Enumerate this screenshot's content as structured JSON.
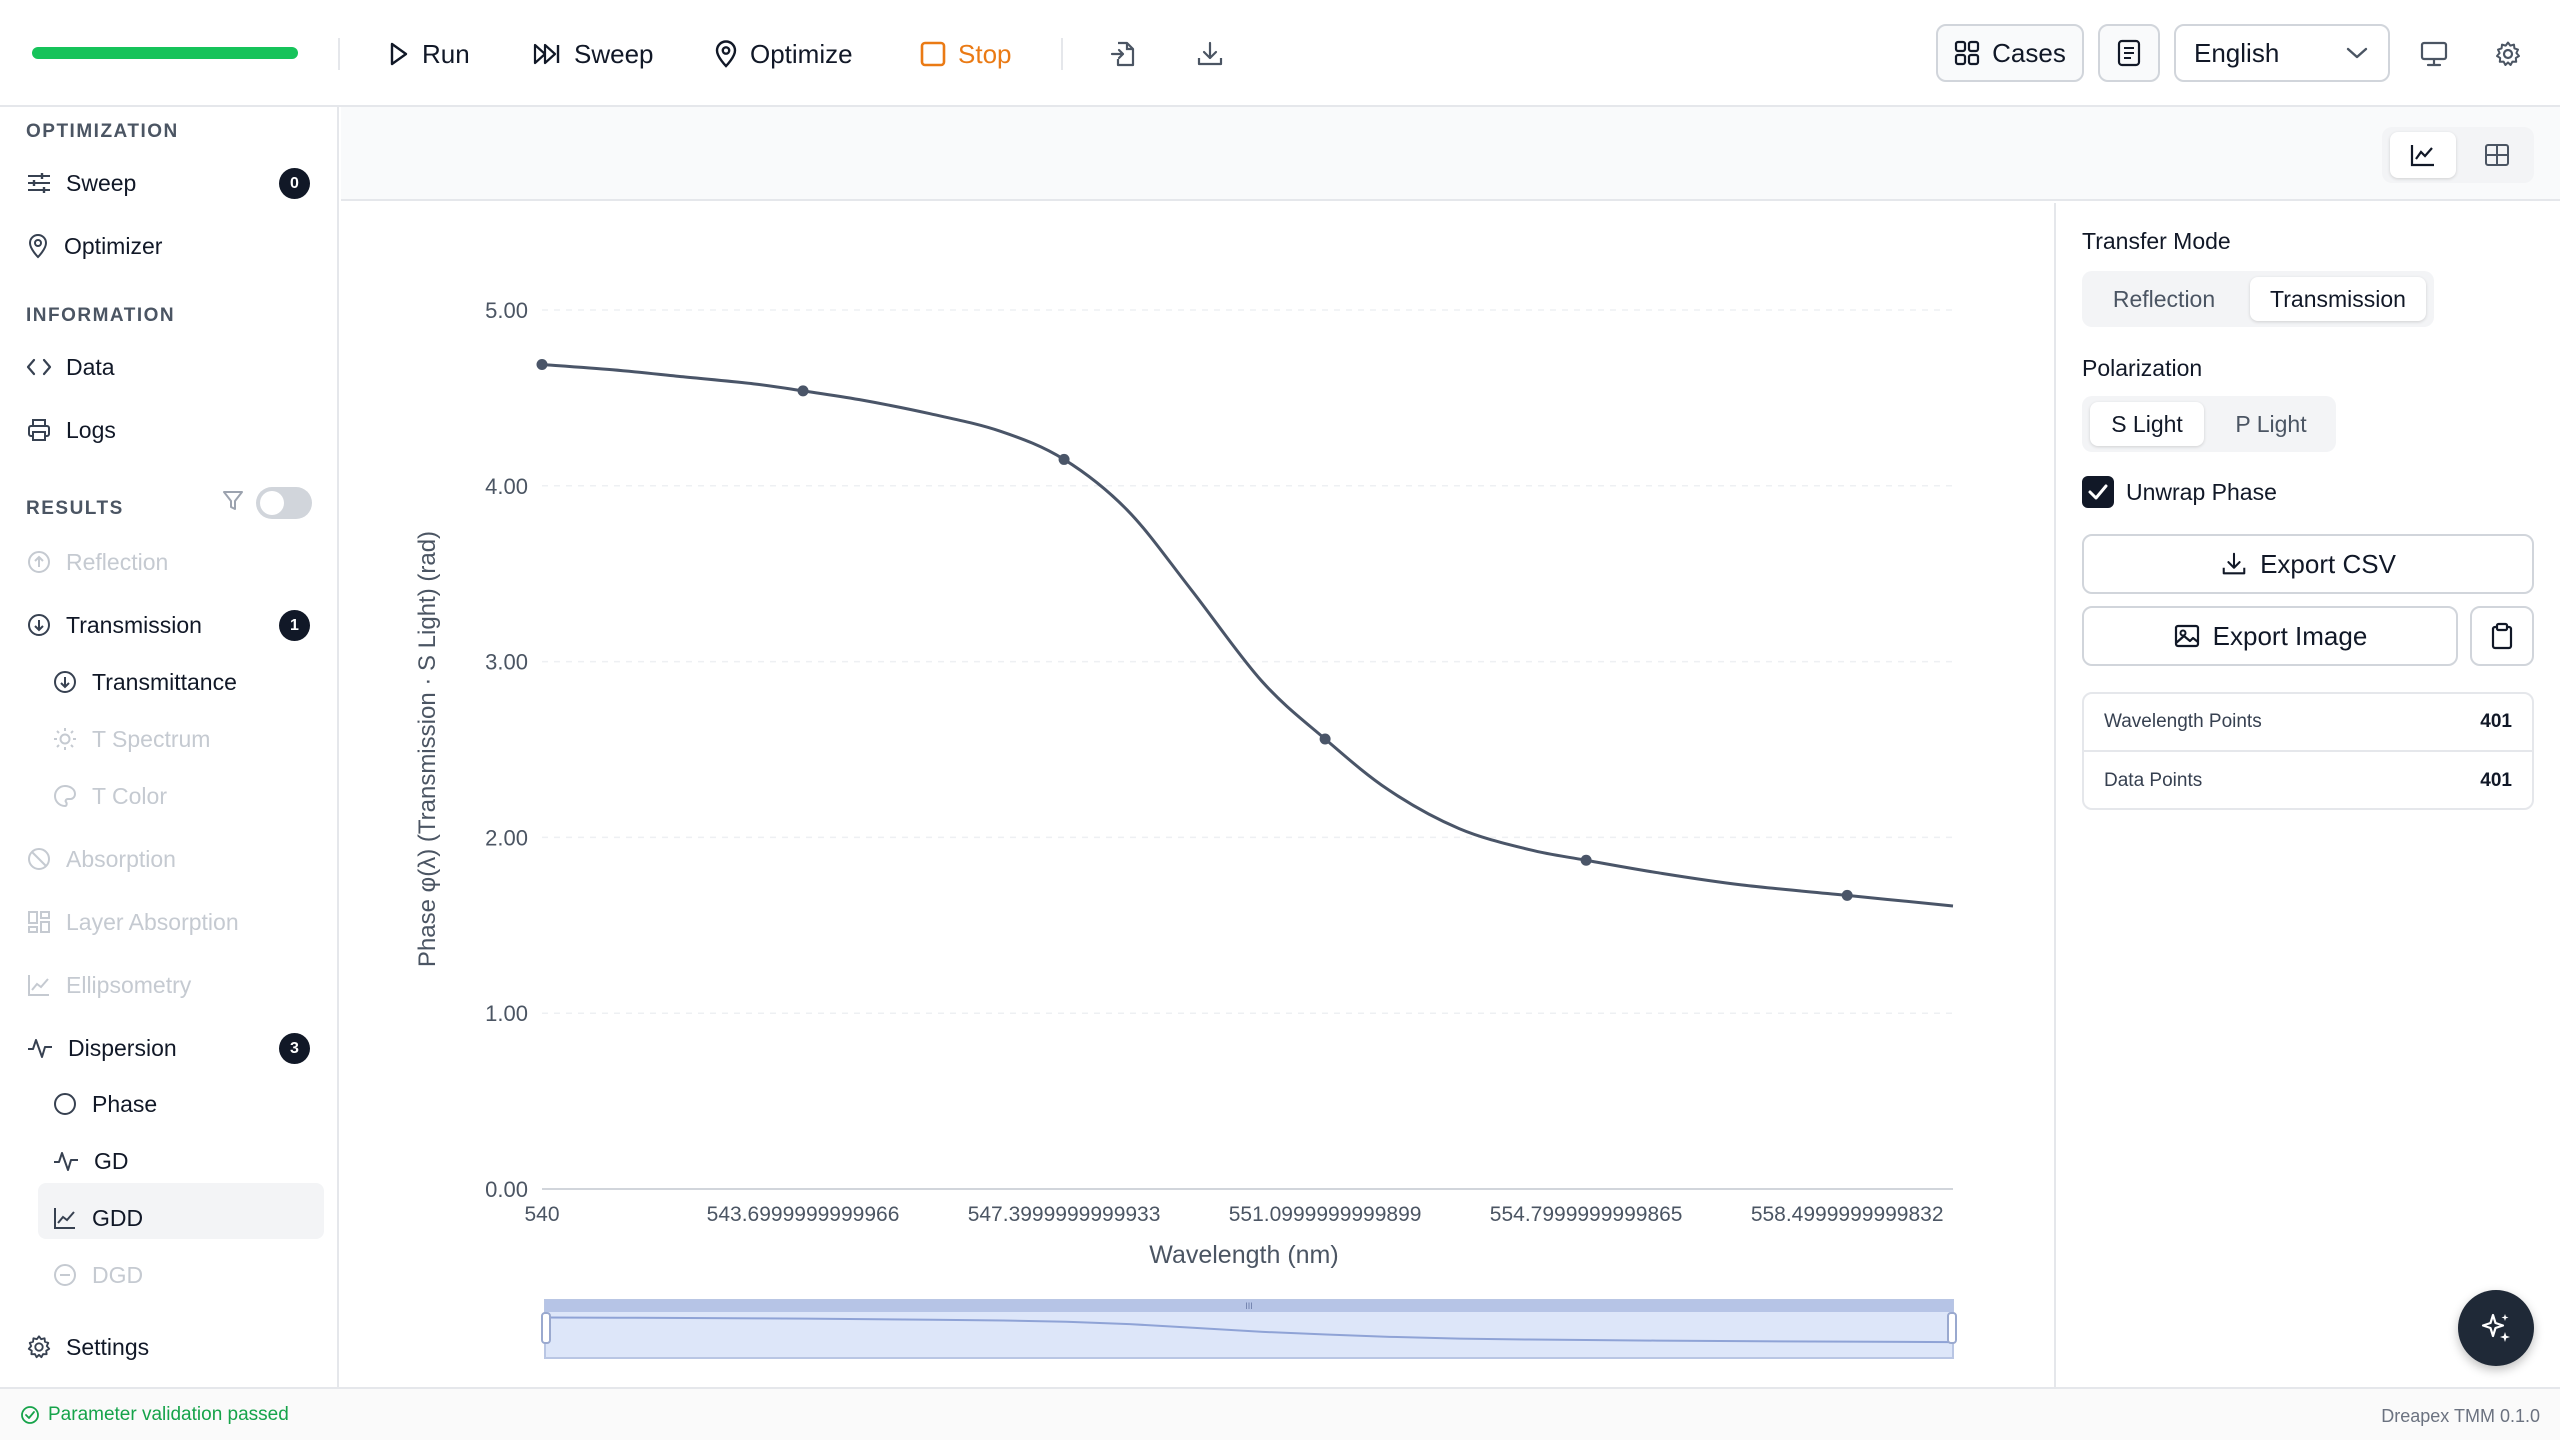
{
  "toolbar": {
    "run": "Run",
    "sweep": "Sweep",
    "optimize": "Optimize",
    "stop": "Stop",
    "cases": "Cases",
    "language": "English"
  },
  "sidebar": {
    "optimization_header": "OPTIMIZATION",
    "sweep": "Sweep",
    "sweep_count": "0",
    "optimizer": "Optimizer",
    "information_header": "INFORMATION",
    "data": "Data",
    "logs": "Logs",
    "results_header": "RESULTS",
    "reflection": "Reflection",
    "transmission": "Transmission",
    "transmission_count": "1",
    "transmittance": "Transmittance",
    "t_spectrum": "T Spectrum",
    "t_color": "T Color",
    "absorption": "Absorption",
    "layer_absorption": "Layer Absorption",
    "ellipsometry": "Ellipsometry",
    "dispersion": "Dispersion",
    "dispersion_count": "3",
    "phase": "Phase",
    "gd": "GD",
    "gdd": "GDD",
    "dgd": "DGD",
    "settings": "Settings"
  },
  "panel": {
    "transfer_mode_label": "Transfer Mode",
    "transfer_modes": [
      "Reflection",
      "Transmission"
    ],
    "transfer_mode_selected": "Transmission",
    "polarization_label": "Polarization",
    "polarizations": [
      "S Light",
      "P Light"
    ],
    "polarization_selected": "S Light",
    "unwrap_label": "Unwrap Phase",
    "unwrap_checked": true,
    "export_csv": "Export CSV",
    "export_image": "Export Image",
    "stats": [
      {
        "label": "Wavelength Points",
        "value": "401"
      },
      {
        "label": "Data Points",
        "value": "401"
      }
    ]
  },
  "status": {
    "message": "Parameter validation passed",
    "version": "Dreapex TMM 0.1.0"
  },
  "colors": {
    "accent": "#111827",
    "progress": "#16c35a",
    "stop": "#ea7a14",
    "line": "#4a5568",
    "ok": "#16a34a"
  },
  "chart_data": {
    "type": "line",
    "xlabel": "Wavelength (nm)",
    "ylabel": "Phase φ(λ) (Transmission · S Light) (rad)",
    "x_ticks": [
      "540",
      "543.6999999999966",
      "547.3999999999933",
      "551.0999999999899",
      "554.7999999999865",
      "558.4999999999832"
    ],
    "y_ticks": [
      "0.00",
      "1.00",
      "2.00",
      "3.00",
      "4.00",
      "5.00"
    ],
    "xlim": [
      540,
      560
    ],
    "ylim": [
      0,
      5
    ],
    "grid": true,
    "progress": 1.0,
    "series": [
      {
        "x": [
          540,
          541,
          542,
          543,
          543.7,
          544.5,
          545.5,
          546.5,
          547.4,
          548.3,
          549.2,
          550.2,
          551.1,
          552,
          553,
          554,
          554.8,
          555.8,
          557,
          558.5,
          560
        ],
        "y": [
          4.69,
          4.66,
          4.62,
          4.58,
          4.54,
          4.49,
          4.41,
          4.31,
          4.15,
          3.86,
          3.41,
          2.89,
          2.56,
          2.27,
          2.05,
          1.93,
          1.87,
          1.8,
          1.73,
          1.67,
          1.61
        ],
        "markers_x": [
          540,
          543.7,
          547.4,
          551.1,
          554.8,
          558.5
        ],
        "markers_y": [
          4.69,
          4.54,
          4.15,
          2.56,
          1.87,
          1.67
        ]
      }
    ]
  }
}
